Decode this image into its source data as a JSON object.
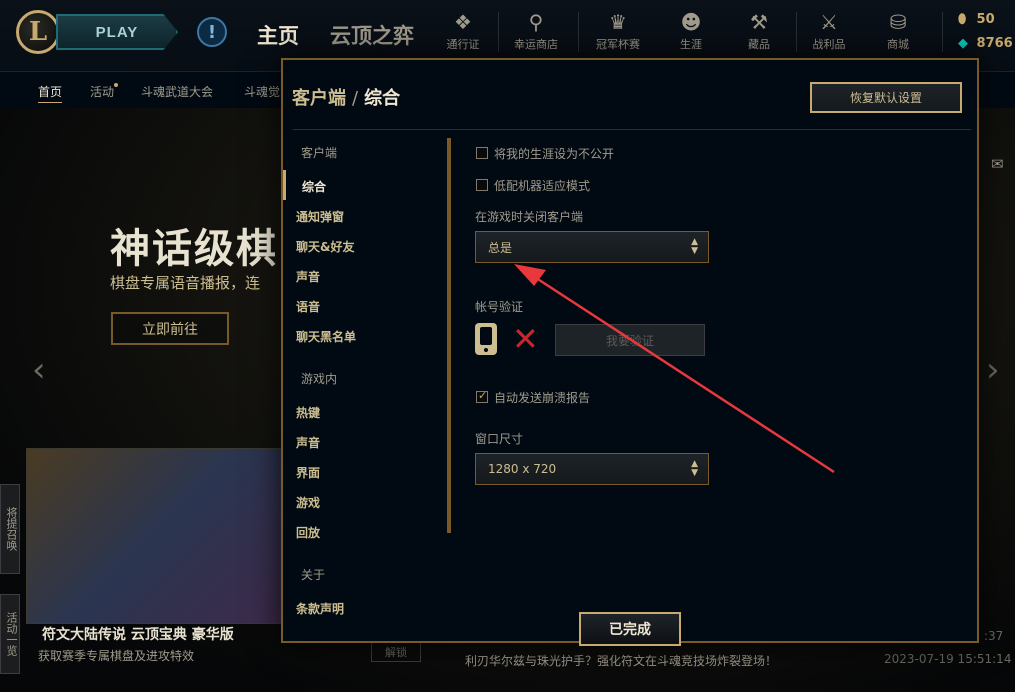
{
  "topbar": {
    "play_label": "PLAY",
    "logo_letter": "L",
    "alert_glyph": "!",
    "tab_home": "主页",
    "tab_tft": "云顶之弈",
    "nav": [
      {
        "label": "通行证",
        "icon": "pass-icon",
        "glyph": "❖"
      },
      {
        "label": "幸运商店",
        "icon": "lucky-shop-icon",
        "glyph": "⚲"
      },
      {
        "label": "冠军杯赛",
        "icon": "trophy-icon",
        "glyph": "♛"
      },
      {
        "label": "生涯",
        "icon": "profile-icon",
        "glyph": "☻"
      },
      {
        "label": "藏品",
        "icon": "collection-icon",
        "glyph": "⚒"
      },
      {
        "label": "战利品",
        "icon": "loot-icon",
        "glyph": "⚔"
      },
      {
        "label": "商城",
        "icon": "store-icon",
        "glyph": "⛁"
      }
    ],
    "currency_rp": "50",
    "currency_be": "8766"
  },
  "subnav": {
    "items": [
      "首页",
      "活动",
      "斗魂武道大会",
      "斗魂觉"
    ]
  },
  "background": {
    "hero_title": "神话级棋",
    "hero_subtitle": "棋盘专属语音播报，连",
    "hero_button": "立即前往",
    "promo_title": "符文大陆传说 云顶宝典 豪华版",
    "promo_subtitle": "获取赛季专属棋盘及进攻特效",
    "side_tab_1": "将提召唤",
    "side_tab_2": "活动一览",
    "unread_label": "解锁",
    "news_text": "利刃华尔兹与珠光护手？强化符文在斗魂竞技场炸裂登场！",
    "news_date": "2023-07-19 15:51:14",
    "news_time_top": ":37"
  },
  "modal": {
    "crumb_parent": "客户端",
    "crumb_current": "综合",
    "crumb_sep": "/",
    "reset_label": "恢复默认设置",
    "done_label": "已完成",
    "nav_sections": [
      {
        "header": "客户端",
        "items": [
          "综合",
          "通知弹窗",
          "聊天&好友",
          "声音",
          "语音",
          "聊天黑名单"
        ]
      },
      {
        "header": "游戏内",
        "items": [
          "热键",
          "声音",
          "界面",
          "游戏",
          "回放"
        ]
      },
      {
        "header": "关于",
        "items": [
          "条款声明"
        ]
      }
    ],
    "options": {
      "private_career": {
        "label": "将我的生涯设为不公开",
        "checked": false
      },
      "low_spec_mode": {
        "label": "低配机器适应模式",
        "checked": false
      },
      "close_client_label": "在游戏时关闭客户端",
      "close_client_value": "总是",
      "account_verify_label": "帐号验证",
      "verify_button": "我要验证",
      "auto_crash_report": {
        "label": "自动发送崩溃报告",
        "checked": true
      },
      "window_size_label": "窗口尺寸",
      "window_size_value": "1280 x 720"
    }
  },
  "colors": {
    "gold": "#c8aa6e",
    "gold_dark": "#785a28",
    "annotation_arrow": "#e8383d",
    "error_red": "#c8262c"
  }
}
